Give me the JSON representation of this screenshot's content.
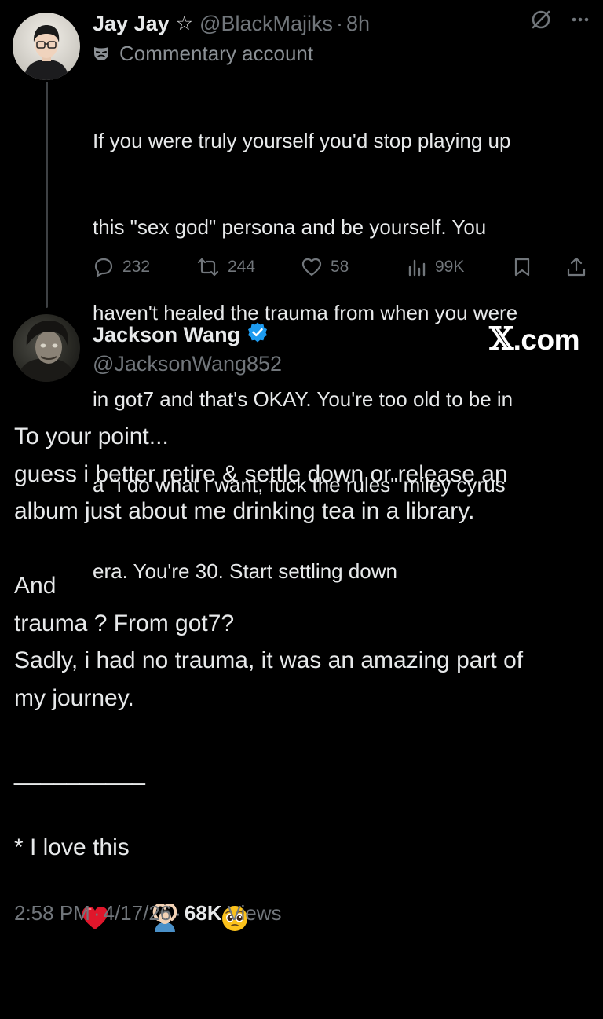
{
  "reply_tweet": {
    "display_name": "Jay Jay",
    "name_icon": "star-outline-icon",
    "handle": "@BlackMajiks",
    "separator": "·",
    "time": "8h",
    "label_icon": "mask-icon",
    "label": "Commentary account",
    "text_lines": [
      "If you were truly yourself you'd stop playing up",
      "this \"sex god\" persona and be yourself. You",
      "haven't healed the trauma from when you were",
      "in got7 and that's OKAY. You're too old to be in",
      "a \"i do what i want, fuck the rules\" miley cyrus",
      "era. You're 30. Start settling down"
    ],
    "actions": {
      "replies": "232",
      "reposts": "244",
      "likes": "58",
      "views": "99K"
    }
  },
  "main_tweet": {
    "display_name": "Jackson Wang",
    "verified_icon": "verified-badge-icon",
    "handle": "@JacksonWang852",
    "brand": ".com",
    "brand_mark": "𝕏",
    "text_lines": [
      "To your point...",
      "guess i better retire & settle down or release an",
      "album just about me drinking tea in a library.",
      "",
      "And",
      "trauma ? From got7?",
      "Sadly, i had no trauma, it was an amazing part of",
      "my journey.",
      "",
      "__________",
      "",
      "* I love this"
    ],
    "emoji_icons": [
      "red-heart-emoji-icon",
      "person-gesturing-ok-emoji-icon",
      "pleading-face-emoji-icon"
    ],
    "footer": {
      "time": "2:58 PM",
      "separator": "·",
      "date": "4/17/26",
      "views_count": "68K",
      "views_label": "Views"
    }
  },
  "colors": {
    "background": "#000000",
    "text_primary": "#e7e9ea",
    "text_secondary": "#71767b",
    "verified_blue": "#1d9bf0",
    "heart_red": "#e0162b"
  }
}
